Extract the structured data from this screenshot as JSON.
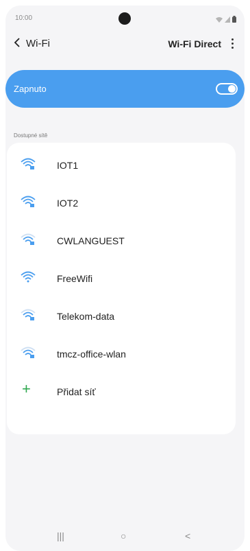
{
  "status_bar": {
    "time": "10:00",
    "icons": [
      "wifi-status-icon",
      "signal-icon",
      "battery-icon"
    ]
  },
  "header": {
    "back_icon": "chevron-left-icon",
    "title": "Wi-Fi",
    "wifi_direct_label": "Wi-Fi Direct",
    "more_icon": "more-vertical-icon"
  },
  "toggle": {
    "label": "Zapnuto",
    "on": true,
    "color": "#4a9eef"
  },
  "section_header": "Dostupné sítě",
  "networks": [
    {
      "name": "IOT1",
      "secured": true,
      "icon": "wifi-lock-icon"
    },
    {
      "name": "IOT2",
      "secured": true,
      "icon": "wifi-lock-icon"
    },
    {
      "name": "CWLANGUEST",
      "secured": true,
      "icon": "wifi-lock-icon"
    },
    {
      "name": "FreeWifi",
      "secured": false,
      "icon": "wifi-icon"
    },
    {
      "name": "Telekom-data",
      "secured": true,
      "icon": "wifi-lock-icon"
    },
    {
      "name": "tmcz-office-wlan",
      "secured": true,
      "icon": "wifi-lock-icon"
    }
  ],
  "add_network": {
    "label": "Přidat síť",
    "icon": "plus-icon",
    "color": "#2fa84f"
  },
  "nav_bar": {
    "recents": "|||",
    "home": "○",
    "back": "<"
  }
}
